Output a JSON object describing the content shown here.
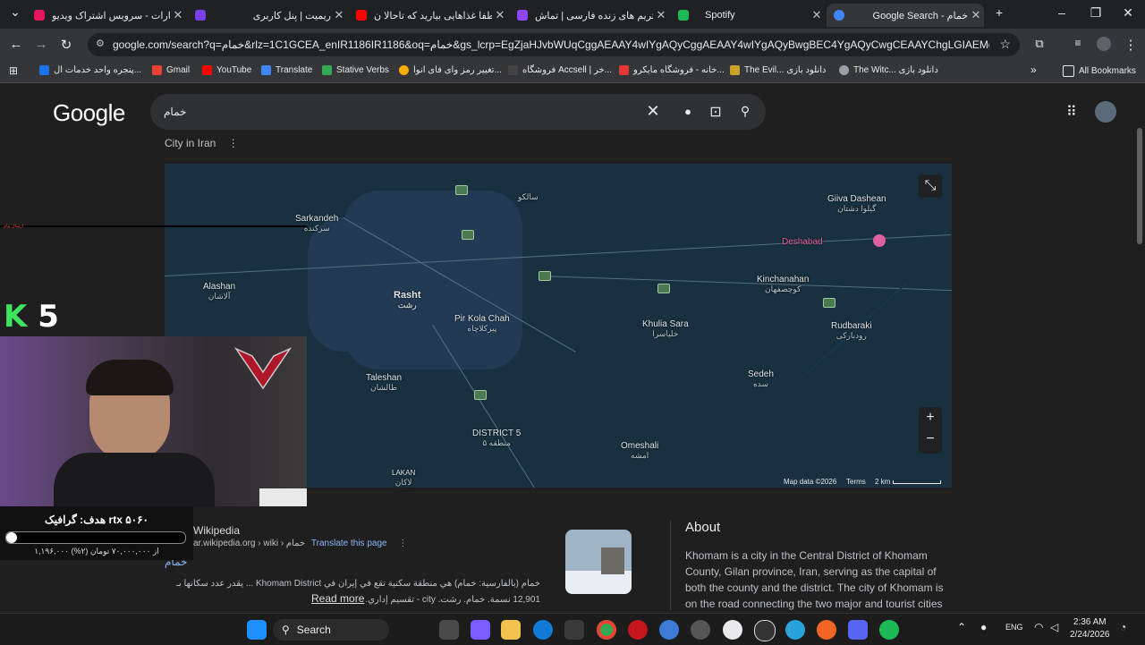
{
  "tabs": [
    {
      "title": "آپارات - سرویس اشتراک ویدیو",
      "color": "#e8175d",
      "active": false
    },
    {
      "title": "ریمیت | پنل کاربری",
      "color": "#7b3ff2",
      "active": false
    },
    {
      "title": "لطفا غذاهایی بیارید که تاحالا ن",
      "color": "#ff0000",
      "active": false
    },
    {
      "title": "استریم های زنده فارسی | تماش",
      "color": "#9146ff",
      "active": false
    },
    {
      "title": "Spotify",
      "color": "#1db954",
      "active": false
    },
    {
      "title": "Google Search - خمام",
      "color": "#4285f4",
      "active": true
    }
  ],
  "tab_icons": {
    "close": "✕",
    "new_tab": "+",
    "tab_search": "⌄"
  },
  "window_controls": {
    "minimize": "–",
    "maximize": "❐",
    "close": "✕"
  },
  "toolbar": {
    "back": "←",
    "forward": "→",
    "reload": "↻",
    "url": "google.com/search?q=خمام&rlz=1C1GCEA_enIR1186IR1186&oq=خمام&gs_lcrp=EgZjaHJvbWUqCggAEAAY4wIYgAQyCggAEAAY4wIYgAQyBwgBEC4YgAQyCwgCEAAYChgLGIAEMgsIAxAAGAoYCxiAB...",
    "star": "☆"
  },
  "bookmarks": [
    {
      "label": "پنجره واحد خدمات ال...",
      "color": "#1a73e8"
    },
    {
      "label": "Gmail",
      "color": "#ea4335"
    },
    {
      "label": "YouTube",
      "color": "#ff0000"
    },
    {
      "label": "Translate",
      "color": "#4285f4"
    },
    {
      "label": "Stative Verbs",
      "color": "#34a853"
    },
    {
      "label": "تغییر رمز وای فای انوا...",
      "color": "#f9ab00"
    },
    {
      "label": "فروشگاه Accsell | خر...",
      "color": "#202124"
    },
    {
      "label": "خانه - فروشگاه مایکرو...",
      "color": "#e53935"
    },
    {
      "label": "The Evil... دانلود بازی",
      "color": "#c9a227"
    },
    {
      "label": "The Witc... دانلود بازی",
      "color": "#9aa0a6"
    }
  ],
  "bookmarks_more": "»",
  "all_bookmarks": "All Bookmarks",
  "search": {
    "logo": "Google",
    "query": "خمام",
    "clear": "✕",
    "mic": "🎤",
    "lens": "⊡",
    "submit": "🔍"
  },
  "knowledge": {
    "subtitle": "City in Iran",
    "more": "⋮"
  },
  "map": {
    "places": [
      {
        "name": "Giiva Dashean",
        "fa": "گیلوا دشتان"
      },
      {
        "name": "Alashan",
        "fa": "آلاشان"
      },
      {
        "name": "Rasht",
        "fa": "رشت"
      },
      {
        "name": "Pir Kola Chah",
        "fa": "پیرکلاچاه"
      },
      {
        "name": "Kinchanahan",
        "fa": "کوچصفهان"
      },
      {
        "name": "Khulia Sara",
        "fa": "خلیاسرا"
      },
      {
        "name": "Rudbaraki",
        "fa": "رودبارکی"
      },
      {
        "name": "Taleshan",
        "fa": "طالشان"
      },
      {
        "name": "Sedeh",
        "fa": "سده"
      },
      {
        "name": "DISTRICT 5",
        "fa": "منطقه ۵"
      },
      {
        "name": "Omeshali",
        "fa": "امشه"
      },
      {
        "name": "LAKAN",
        "fa": "لاکان"
      },
      {
        "name": "Sarkandeh",
        "fa": "سرکنده"
      },
      {
        "name": "",
        "fa": "سالکو"
      }
    ],
    "pin_label": "Deshabad",
    "route_numbers": [
      "49",
      "49",
      "49",
      "49",
      "49",
      "310"
    ],
    "zoom_in": "+",
    "zoom_out": "−",
    "collapse": "⤡",
    "attribution": "Map data ©2026",
    "terms": "Terms",
    "scale": "2 km"
  },
  "stream_overlay": {
    "logo_k": "K",
    "logo_num": "5",
    "goal_title": "هدف: گرافیک rtx ۵۰۶۰",
    "goal_progress": "۱,۱۹۶,۰۰۰ از ۷۰,۰۰۰,۰۰۰ تومان (۲%)",
    "goal_fraction": 0.02,
    "ticker": "ارسال پیام"
  },
  "result": {
    "site": "Wikipedia",
    "url": "ar.wikipedia.org › wiki › خمام",
    "translate": "Translate this page",
    "title": "خمام",
    "snippet": "خمام (بالفارسية: خمام) هي منطقة سكنية تقع في إيران في Khomam District ... يقدر عدد سكانها بـ 12,901 نسمة. خمام. رشت. city - تقسيم إداري.",
    "read_more": "Read more"
  },
  "about": {
    "heading": "About",
    "text": "Khomam is a city in the Central District of Khomam County, Gilan province, Iran, serving as the capital of both the county and the district. The city of Khomam is on the road connecting the two major and tourist cities of Gilan"
  },
  "taskbar": {
    "search_label": "Search",
    "time": "2:36 AM",
    "date": "2/24/2026",
    "lang": "ENG"
  }
}
